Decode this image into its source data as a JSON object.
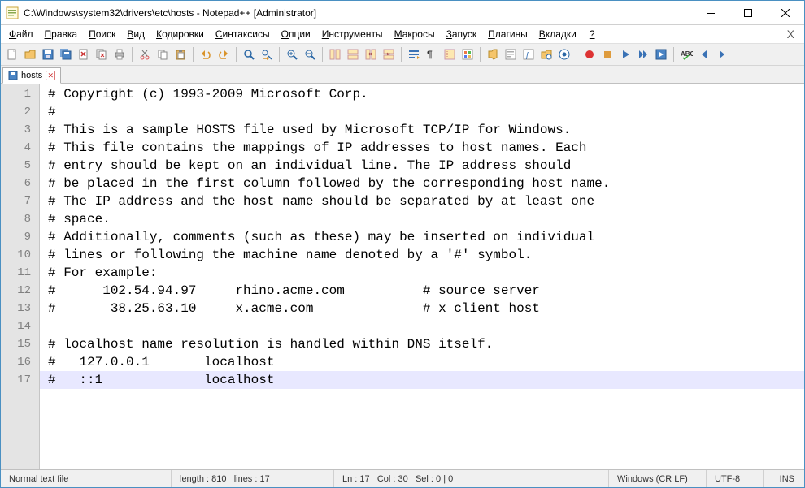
{
  "window": {
    "title": "C:\\Windows\\system32\\drivers\\etc\\hosts - Notepad++ [Administrator]"
  },
  "menu": {
    "items": [
      {
        "hot": "Ф",
        "rest": "айл"
      },
      {
        "hot": "П",
        "rest": "равка"
      },
      {
        "hot": "П",
        "rest": "оиск"
      },
      {
        "hot": "В",
        "rest": "ид"
      },
      {
        "hot": "К",
        "rest": "одировки"
      },
      {
        "hot": "С",
        "rest": "интаксисы"
      },
      {
        "hot": "О",
        "rest": "пции"
      },
      {
        "hot": "И",
        "rest": "нструменты"
      },
      {
        "hot": "М",
        "rest": "акросы"
      },
      {
        "hot": "З",
        "rest": "апуск"
      },
      {
        "hot": "П",
        "rest": "лагины"
      },
      {
        "hot": "В",
        "rest": "кладки"
      },
      {
        "hot": "?",
        "rest": ""
      }
    ]
  },
  "tab": {
    "name": "hosts"
  },
  "editor": {
    "lines": [
      "# Copyright (c) 1993-2009 Microsoft Corp.",
      "#",
      "# This is a sample HOSTS file used by Microsoft TCP/IP for Windows.",
      "# This file contains the mappings of IP addresses to host names. Each",
      "# entry should be kept on an individual line. The IP address should",
      "# be placed in the first column followed by the corresponding host name.",
      "# The IP address and the host name should be separated by at least one",
      "# space.",
      "# Additionally, comments (such as these) may be inserted on individual",
      "# lines or following the machine name denoted by a '#' symbol.",
      "# For example:",
      "#      102.54.94.97     rhino.acme.com          # source server",
      "#       38.25.63.10     x.acme.com              # x client host",
      "",
      "# localhost name resolution is handled within DNS itself.",
      "#   127.0.0.1       localhost",
      "#   ::1             localhost"
    ],
    "current_line": 17
  },
  "status": {
    "filetype": "Normal text file",
    "length_label": "length :",
    "length": "810",
    "lines_label": "lines :",
    "lines": "17",
    "ln_label": "Ln :",
    "ln": "17",
    "col_label": "Col :",
    "col": "30",
    "sel_label": "Sel :",
    "sel": "0 | 0",
    "eol": "Windows (CR LF)",
    "encoding": "UTF-8",
    "ins": "INS"
  }
}
